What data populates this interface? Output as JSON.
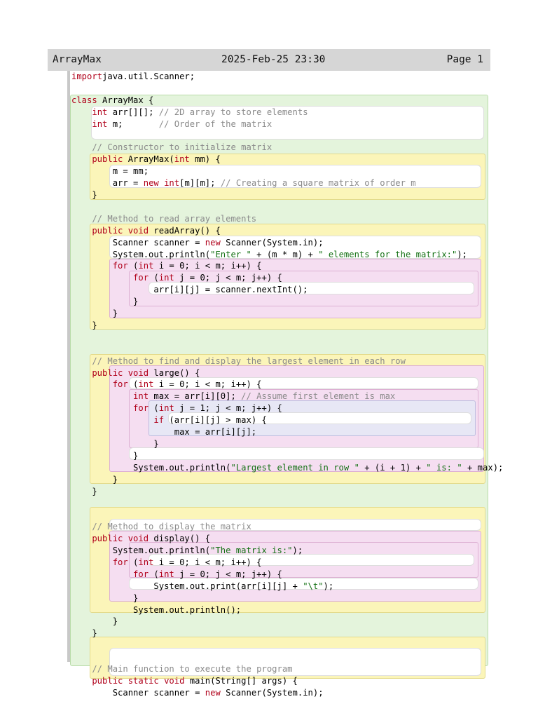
{
  "header": {
    "title": "ArrayMax",
    "datetime": "2025-Feb-25 23:30",
    "page": "Page 1"
  },
  "code": {
    "lines": [
      [
        [
          "kw",
          "import"
        ],
        [
          "",
          "java.util.Scanner;"
        ]
      ],
      [],
      [
        [
          "kw",
          "class"
        ],
        [
          "",
          " ArrayMax {"
        ]
      ],
      [
        [
          "",
          "    "
        ],
        [
          "kw",
          "int"
        ],
        [
          "",
          " arr[][]; "
        ],
        [
          "cm",
          "// 2D array to store elements"
        ]
      ],
      [
        [
          "",
          "    "
        ],
        [
          "kw",
          "int"
        ],
        [
          "",
          " m;       "
        ],
        [
          "cm",
          "// Order of the matrix"
        ]
      ],
      [],
      [
        [
          "cm",
          "    // Constructor to initialize matrix"
        ]
      ],
      [
        [
          "kw",
          "    public"
        ],
        [
          "",
          " ArrayMax("
        ],
        [
          "kw",
          "int"
        ],
        [
          "",
          " mm) {"
        ]
      ],
      [
        [
          "",
          "        m = mm;"
        ]
      ],
      [
        [
          "",
          "        arr = "
        ],
        [
          "kw",
          "new"
        ],
        [
          "kw",
          " int"
        ],
        [
          "",
          "[m][m]; "
        ],
        [
          "cm",
          "// Creating a square matrix of order m"
        ]
      ],
      [
        [
          "",
          "    }"
        ]
      ],
      [],
      [
        [
          "cm",
          "    // Method to read array elements"
        ]
      ],
      [
        [
          "kw",
          "    public void"
        ],
        [
          "",
          " readArray() {"
        ]
      ],
      [
        [
          "",
          "        Scanner scanner = "
        ],
        [
          "kw",
          "new"
        ],
        [
          "",
          " Scanner(System.in);"
        ]
      ],
      [
        [
          "",
          "        System.out.println("
        ],
        [
          "st",
          "\"Enter \""
        ],
        [
          "",
          " + (m * m) + "
        ],
        [
          "st",
          "\" elements for the matrix:\""
        ],
        [
          "",
          ");"
        ]
      ],
      [
        [
          "kw",
          "        for"
        ],
        [
          "",
          " ("
        ],
        [
          "kw",
          "int"
        ],
        [
          "",
          " i = 0; i < m; i++) {"
        ]
      ],
      [
        [
          "kw",
          "            for"
        ],
        [
          "",
          " ("
        ],
        [
          "kw",
          "int"
        ],
        [
          "",
          " j = 0; j < m; j++) {"
        ]
      ],
      [
        [
          "",
          "                arr[i][j] = scanner.nextInt();"
        ]
      ],
      [
        [
          "",
          "            }"
        ]
      ],
      [
        [
          "",
          "        }"
        ]
      ],
      [
        [
          "",
          "    }"
        ]
      ],
      [],
      [],
      [
        [
          "cm",
          "    // Method to find and display the largest element in each row"
        ]
      ],
      [
        [
          "kw",
          "    public void"
        ],
        [
          "",
          " large() {"
        ]
      ],
      [
        [
          "kw",
          "        for"
        ],
        [
          "",
          " ("
        ],
        [
          "kw",
          "int"
        ],
        [
          "",
          " i = 0; i < m; i++) {"
        ]
      ],
      [
        [
          "kw",
          "            int"
        ],
        [
          "",
          " max = arr[i][0]; "
        ],
        [
          "cm",
          "// Assume first element is max"
        ]
      ],
      [
        [
          "kw",
          "            for"
        ],
        [
          "",
          " ("
        ],
        [
          "kw",
          "int"
        ],
        [
          "",
          " j = 1; j < m; j++) {"
        ]
      ],
      [
        [
          "kw",
          "                if"
        ],
        [
          "",
          " (arr[i][j] > max) {"
        ]
      ],
      [
        [
          "",
          "                    max = arr[i][j];"
        ]
      ],
      [
        [
          "",
          "                }"
        ]
      ],
      [
        [
          "",
          "            }"
        ]
      ],
      [
        [
          "",
          "            System.out.println("
        ],
        [
          "st",
          "\"Largest element in row \""
        ],
        [
          "",
          " + (i + 1) + "
        ],
        [
          "st",
          "\" is: \""
        ],
        [
          "",
          " + max);"
        ]
      ],
      [
        [
          "",
          "        }"
        ]
      ],
      [
        [
          "",
          "    }"
        ]
      ],
      [],
      [],
      [
        [
          "cm",
          "    // Method to display the matrix"
        ]
      ],
      [
        [
          "kw",
          "    public void"
        ],
        [
          "",
          " display() {"
        ]
      ],
      [
        [
          "",
          "        System.out.println("
        ],
        [
          "st",
          "\"The matrix is:\""
        ],
        [
          "",
          ");"
        ]
      ],
      [
        [
          "kw",
          "        for"
        ],
        [
          "",
          " ("
        ],
        [
          "kw",
          "int"
        ],
        [
          "",
          " i = 0; i < m; i++) {"
        ]
      ],
      [
        [
          "kw",
          "            for"
        ],
        [
          "",
          " ("
        ],
        [
          "kw",
          "int"
        ],
        [
          "",
          " j = 0; j < m; j++) {"
        ]
      ],
      [
        [
          "",
          "                System.out.print(arr[i][j] + "
        ],
        [
          "st",
          "\"\\t\""
        ],
        [
          "",
          ");"
        ]
      ],
      [
        [
          "",
          "            }"
        ]
      ],
      [
        [
          "",
          "            System.out.println();"
        ]
      ],
      [
        [
          "",
          "        }"
        ]
      ],
      [
        [
          "",
          "    }"
        ]
      ],
      [],
      [],
      [
        [
          "cm",
          "    // Main function to execute the program"
        ]
      ],
      [
        [
          "kw",
          "    public static void"
        ],
        [
          "",
          " main(String[] args) {"
        ]
      ],
      [
        [
          "",
          "        Scanner scanner = "
        ],
        [
          "kw",
          "new"
        ],
        [
          "",
          " Scanner(System.in);"
        ]
      ]
    ]
  },
  "colors": {
    "keyword": "#b0001a",
    "comment": "#8a8a8a",
    "string": "#137013",
    "header_bg": "#d6d6d6"
  }
}
